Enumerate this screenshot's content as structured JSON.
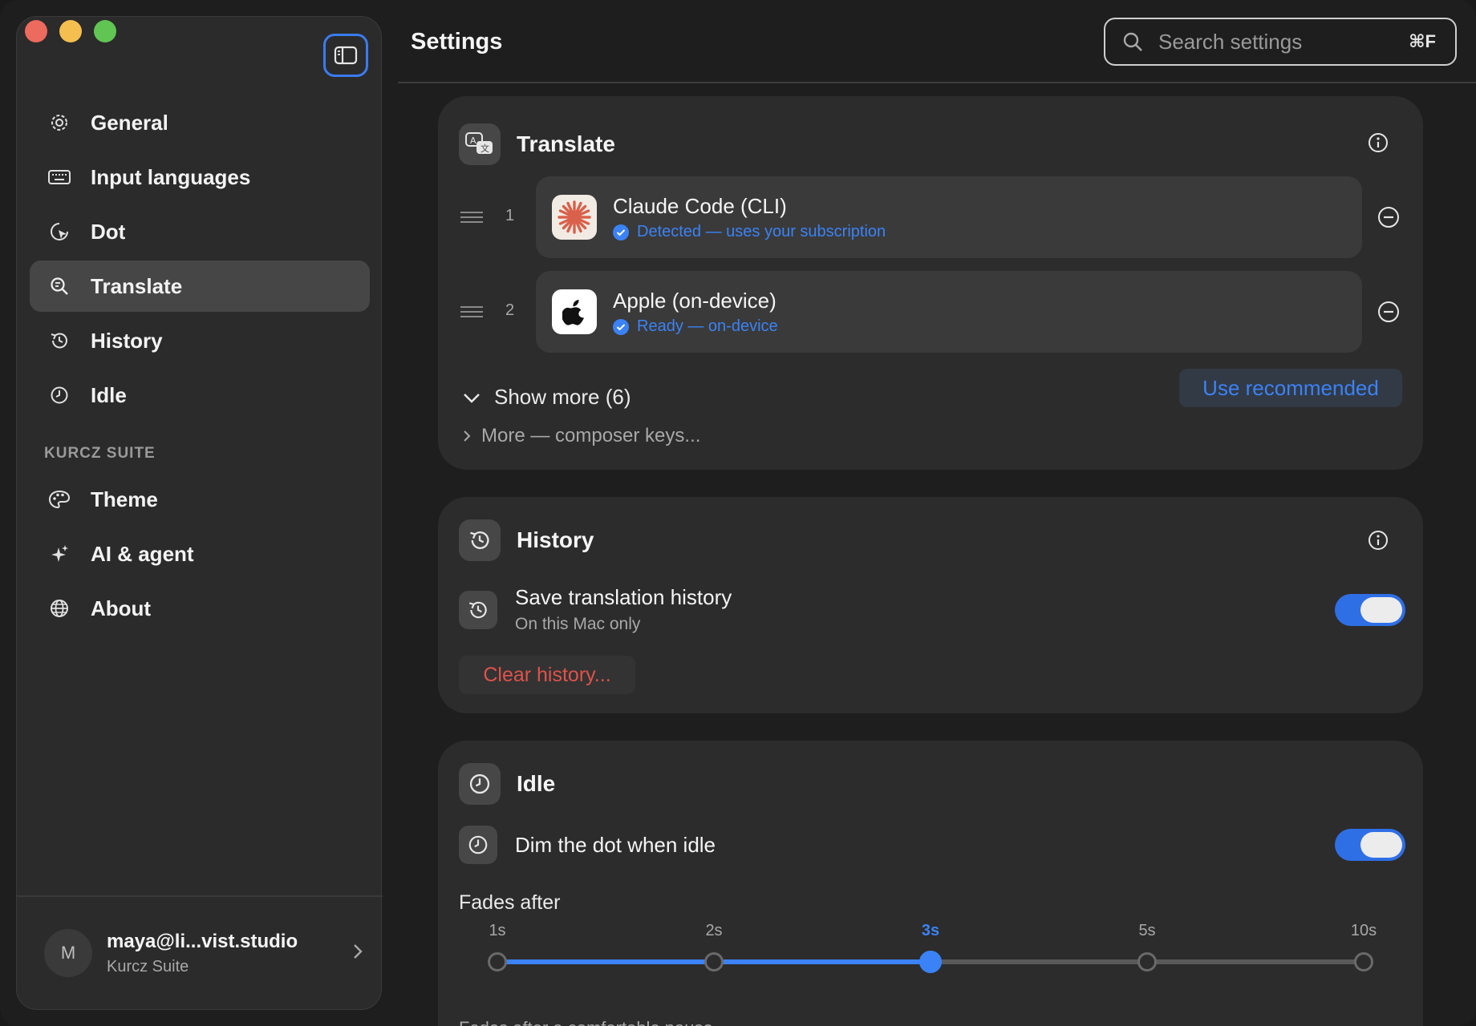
{
  "sidebar": {
    "items": [
      {
        "key": "general",
        "label": "General",
        "icon": "gear-icon"
      },
      {
        "key": "input-languages",
        "label": "Input languages",
        "icon": "keyboard-icon"
      },
      {
        "key": "dot",
        "label": "Dot",
        "icon": "cursor-icon"
      },
      {
        "key": "translate",
        "label": "Translate",
        "icon": "magnifier-icon",
        "active": true
      },
      {
        "key": "history",
        "label": "History",
        "icon": "history-icon"
      },
      {
        "key": "idle",
        "label": "Idle",
        "icon": "clock-icon"
      }
    ],
    "section_label": "KURCZ SUITE",
    "suite_items": [
      {
        "key": "theme",
        "label": "Theme",
        "icon": "palette-icon"
      },
      {
        "key": "ai-agent",
        "label": "AI & agent",
        "icon": "sparkle-icon"
      },
      {
        "key": "about",
        "label": "About",
        "icon": "globe-icon"
      }
    ],
    "account": {
      "initial": "M",
      "email": "maya@li...vist.studio",
      "subtitle": "Kurcz Suite"
    }
  },
  "header": {
    "title": "Settings",
    "search": {
      "placeholder": "Search settings",
      "shortcut": "⌘F"
    }
  },
  "translate": {
    "title": "Translate",
    "providers": [
      {
        "index": "1",
        "name": "Claude Code (CLI)",
        "status": "Detected — uses your subscription",
        "logo": "claude-logo-icon"
      },
      {
        "index": "2",
        "name": "Apple (on-device)",
        "status": "Ready — on-device",
        "logo": "apple-logo-icon"
      }
    ],
    "show_more": "Show more (6)",
    "use_recommended": "Use recommended",
    "more_keys": "More — composer keys..."
  },
  "history": {
    "title": "History",
    "save_title": "Save translation history",
    "save_sub": "On this Mac only",
    "save_enabled": true,
    "clear_label": "Clear history..."
  },
  "idle": {
    "title": "Idle",
    "dim_title": "Dim the dot when idle",
    "dim_enabled": true,
    "fades_label": "Fades after",
    "options": [
      "1s",
      "2s",
      "3s",
      "5s",
      "10s"
    ],
    "selected_index": 2,
    "note": "Fades after a comfortable pause."
  },
  "colors": {
    "accent": "#3b82f6",
    "danger": "#e0524a"
  }
}
